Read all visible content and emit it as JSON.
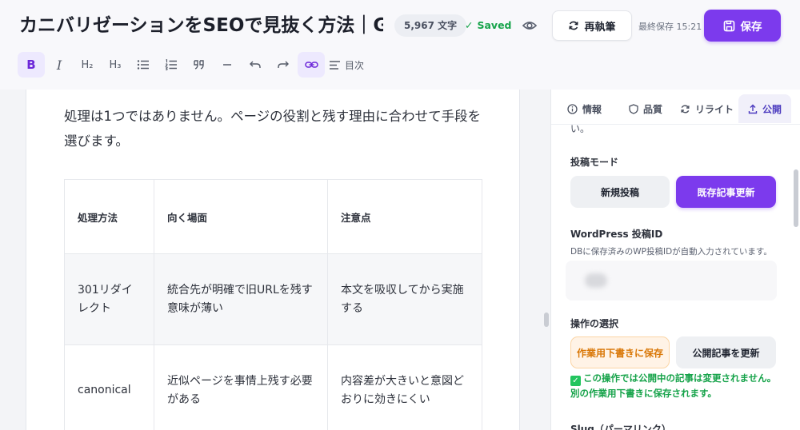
{
  "header": {
    "title": "カニバリゼーションをSEOで見抜く方法｜GSC",
    "word_count": "5,967 文字",
    "saved_label": "Saved",
    "rewrite_label": "再執筆",
    "last_saved": "最終保存 15:21",
    "save_label": "保存"
  },
  "toolbar": {
    "items": [
      "bold",
      "italic",
      "h2",
      "h3",
      "bullet-list",
      "numbered-list",
      "quote",
      "horizontal-rule",
      "undo",
      "redo",
      "link",
      "toc"
    ],
    "h2_label": "H₂",
    "h3_label": "H₃",
    "toc_label": "目次"
  },
  "editor": {
    "paragraph": "処理は1つではありません。ページの役割と残す理由に合わせて手段を選びます。",
    "table": {
      "headers": [
        "処理方法",
        "向く場面",
        "注意点"
      ],
      "rows": [
        [
          "301リダイレクト",
          "統合先が明確で旧URLを残す意味が薄い",
          "本文を吸収してから実施する"
        ],
        [
          "canonical",
          "近似ページを事情上残す必要がある",
          "内容差が大きいと意図どおりに効きにくい"
        ]
      ]
    }
  },
  "side_panel": {
    "tabs": [
      {
        "label": "情報",
        "icon": "info-icon"
      },
      {
        "label": "品質",
        "icon": "shield-icon"
      },
      {
        "label": "リライト",
        "icon": "refresh-icon"
      },
      {
        "label": "公開",
        "icon": "upload-icon",
        "active": true
      }
    ],
    "cut_text": "い。",
    "post_mode_label": "投稿モード",
    "new_post_label": "新規投稿",
    "update_post_label": "既存記事更新",
    "wp_id_label": "WordPress 投稿ID",
    "wp_id_help": "DBに保存済みのWP投稿IDが自動入力されています。",
    "action_label": "操作の選択",
    "draft_save_label": "作業用下書きに保存",
    "update_published_label": "公開記事を更新",
    "note": "この操作では公開中の記事は変更されません。別の作業用下書きに保存されます。",
    "slug_label": "Slug（パーマリンク）"
  },
  "colors": {
    "accent": "#7c3aed",
    "success": "#16a34a",
    "warning": "#d97706"
  }
}
